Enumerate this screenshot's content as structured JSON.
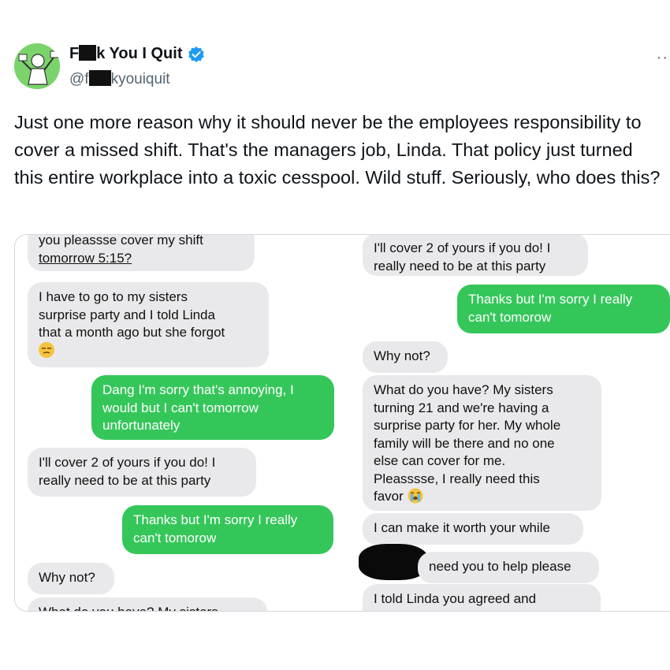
{
  "tweet": {
    "name_prefix": "F",
    "name_suffix": "k You I Quit",
    "handle_prefix": "@f",
    "handle_suffix": "kyouiquit",
    "more_label": "··",
    "text": "Just one more reason why it should never be the employees responsibility to cover a missed shift. That's the managers job, Linda. That policy just turned this entire workplace into a toxic cesspool. Wild stuff. Seriously, who does this?"
  },
  "colors": {
    "avatar_bg": "#7bd36b",
    "verified": "#1d9bf0",
    "bubble_gray": "#e9e9eb",
    "bubble_green": "#35c65a"
  },
  "icons": {
    "verified": "verified-badge-icon",
    "unamused": "unamused-face-emoji",
    "crying": "loudly-crying-face-emoji",
    "more": "more-dots-icon"
  },
  "left_column": [
    {
      "type": "gray",
      "lines": [
        "you pleassse cover my shift",
        "tomorrow 5:15?"
      ]
    },
    {
      "type": "gray",
      "lines": [
        "I have to go to my sisters",
        "surprise party and I told Linda",
        "that a month ago but she forgot"
      ]
    },
    {
      "type": "green",
      "lines": [
        "Dang I'm sorry that's annoying, I",
        "would but I can't tomorrow",
        "unfortunately"
      ]
    },
    {
      "type": "gray",
      "lines": [
        "I'll cover 2 of yours if you do! I",
        "really need to be at this party"
      ]
    },
    {
      "type": "green",
      "lines": [
        "Thanks but I'm sorry I really",
        "can't tomorow"
      ]
    },
    {
      "type": "gray",
      "lines": [
        "Why not?"
      ]
    },
    {
      "type": "gray",
      "lines": [
        "What do you have? My sisters"
      ]
    }
  ],
  "right_column": [
    {
      "type": "gray",
      "lines": [
        "I'll cover 2 of yours if you do! I",
        "really need to be at this party"
      ]
    },
    {
      "type": "green",
      "lines": [
        "Thanks but I'm sorry I really",
        "can't tomorow"
      ]
    },
    {
      "type": "gray",
      "lines": [
        "Why not?"
      ]
    },
    {
      "type": "gray",
      "lines": [
        "What do you have? My sisters",
        "turning 21 and we're having a",
        "surprise party for her. My whole",
        "family will be there and no one",
        "else can cover for me.",
        "Pleasssse, I really need this",
        "favor"
      ]
    },
    {
      "type": "gray",
      "lines": [
        "I can make it worth your while"
      ]
    },
    {
      "type": "gray",
      "lines": [
        "need you to help please"
      ]
    },
    {
      "type": "gray",
      "lines": [
        "I told Linda you agreed and"
      ]
    }
  ]
}
